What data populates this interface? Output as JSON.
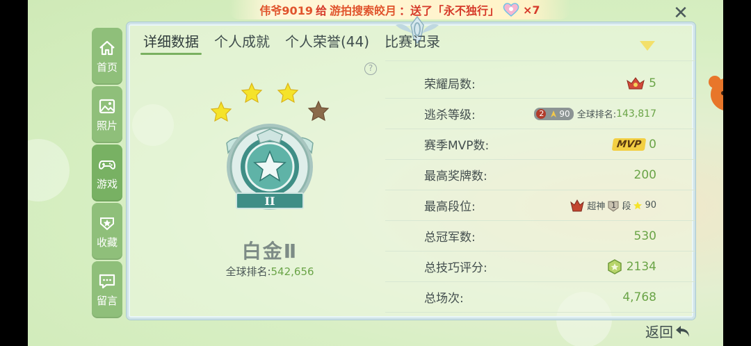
{
  "notification": {
    "sender": "伟爷9019",
    "verb": "给",
    "receiver": "游拍搜索皎月",
    "action": "：送了「永不独行」",
    "count": "×7"
  },
  "sidebar": {
    "items": [
      {
        "label": "首页",
        "icon": "home-icon"
      },
      {
        "label": "照片",
        "icon": "photo-icon"
      },
      {
        "label": "游戏",
        "icon": "gamepad-icon"
      },
      {
        "label": "收藏",
        "icon": "star-collect-icon"
      },
      {
        "label": "留言",
        "icon": "message-icon"
      }
    ],
    "active_index": 2
  },
  "tabs": [
    {
      "label": "详细数据",
      "active": true
    },
    {
      "label": "个人成就",
      "active": false
    },
    {
      "label": "个人荣誉(44)",
      "active": false
    },
    {
      "label": "比赛记录",
      "active": false
    }
  ],
  "help_label": "?",
  "rank": {
    "title": "白金Ⅱ",
    "emblem_numeral": "II",
    "global_label": "全球排名:",
    "global_value": "542,656",
    "stars_filled": 3,
    "stars_total": 4
  },
  "stats": [
    {
      "label": "荣耀局数:",
      "value": "5"
    },
    {
      "label": "逃杀等级:",
      "level_badge": "2",
      "level_num": "90",
      "rank_label": "全球排名:",
      "rank_value": "143,817"
    },
    {
      "label": "赛季MVP数:",
      "tag": "MVP",
      "value": "0"
    },
    {
      "label": "最高奖牌数:",
      "value": "200"
    },
    {
      "label": "最高段位:",
      "tier": "超神",
      "seg": "段",
      "seg_num": "1",
      "stars": "90"
    },
    {
      "label": "总冠军数:",
      "value": "530"
    },
    {
      "label": "总技巧评分:",
      "value": "2134"
    },
    {
      "label": "总场次:",
      "value": "4,768"
    }
  ],
  "back_label": "返回",
  "colors": {
    "accent": "#79b060",
    "value_green": "#6aa447",
    "sidebar": "#8fbf7a"
  }
}
